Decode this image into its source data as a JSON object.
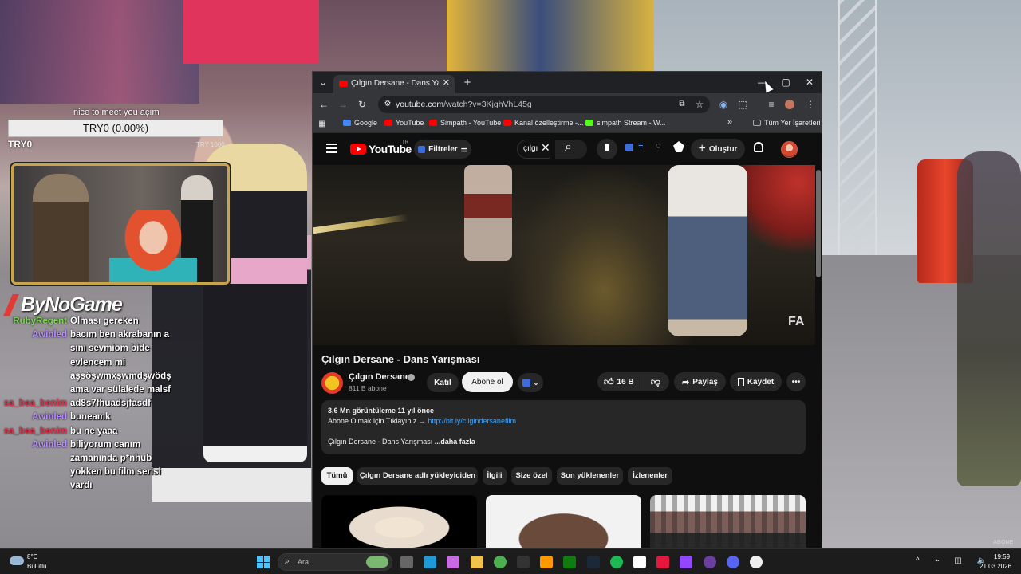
{
  "overlay": {
    "goal_text": "nice to meet you açım",
    "goal_label": "TRY0 (0.00%)",
    "goal_progress": 0,
    "goal_left": "TRY0",
    "goal_right": "TRY 1000",
    "logo_text": "ByNoGame",
    "watermark": "ABONE",
    "chat": [
      {
        "user": "RubyRegent",
        "msg": "Olması gereken",
        "color": "#7fd35a"
      },
      {
        "user": "Awinled",
        "msg": "bacım ben akrabanın a",
        "color": "#b98cff"
      },
      {
        "user": "",
        "msg": "sını sevmiom bide",
        "color": "#ffffff"
      },
      {
        "user": "",
        "msg": "evlencem mi",
        "color": "#ffffff"
      },
      {
        "user": "",
        "msg": "aşsöşwmxşwmdşwödş",
        "color": "#ffffff"
      },
      {
        "user": "",
        "msg": "ama var sülalede malsf",
        "color": "#ffffff"
      },
      {
        "user": "sa_bea_benim",
        "msg": "ad8s7fhuadsjfasdf",
        "color": "#e8304a"
      },
      {
        "user": "Awinled",
        "msg": "buneamk",
        "color": "#b98cff"
      },
      {
        "user": "sa_bea_benim",
        "msg": "bu ne yaaa",
        "color": "#e8304a"
      },
      {
        "user": "Awinled",
        "msg": "biliyorum canım",
        "color": "#b98cff"
      },
      {
        "user": "",
        "msg": "zamanında p*nhub",
        "color": "#ffffff"
      },
      {
        "user": "",
        "msg": "yokken bu film serisi",
        "color": "#ffffff"
      },
      {
        "user": "",
        "msg": "vardı",
        "color": "#ffffff"
      }
    ]
  },
  "browser": {
    "tab_title": "Çılgın Dersane - Dans Yarışması",
    "tab_close": "✕",
    "new_tab": "+",
    "tab_search": "⌄",
    "win_min": "—",
    "win_max": "▢",
    "win_close": "✕",
    "nav_back": "←",
    "nav_forward": "→",
    "nav_reload": "↻",
    "url_host": "youtube.com",
    "url_path": "/watch?v=3KjghVhL45g",
    "star": "☆",
    "menu": "⋮",
    "bookmarks": [
      {
        "label": "Google",
        "color": "#4285f4"
      },
      {
        "label": "YouTube",
        "color": "#ff0000"
      },
      {
        "label": "Simpath - YouTube",
        "color": "#ff0000"
      },
      {
        "label": "Kanal özelleştirme -...",
        "color": "#ff0000"
      },
      {
        "label": "simpath Stream - W...",
        "color": "#53fc18"
      }
    ],
    "bookmarks_more": "»",
    "all_bookmarks": "Tüm Yer İşaretleri"
  },
  "youtube": {
    "logo": "YouTube",
    "logo_tr": "TR",
    "filters": "Filtreler",
    "search_value": "çılgı",
    "search_clear": "✕",
    "search_icon": "⌕",
    "create": "Oluştur",
    "create_plus": "+",
    "video_watermark": "FA",
    "video_title": "Çılgın Dersane - Dans Yarışması",
    "channel_name": "Çılgın Dersane",
    "channel_subs": "811 B abone",
    "join": "Katıl",
    "subscribe": "Abone ol",
    "likes": "16 B",
    "share": "Paylaş",
    "save": "Kaydet",
    "more": "•••",
    "desc_stats": "3,6 Mn görüntüleme  11 yıl önce",
    "desc_line": "Abone Olmak için Tıklayınız → ",
    "desc_link": "http://bit.ly/cilgindersanefilm",
    "desc_title": "Çılgın Dersane - Dans Yarışması ",
    "desc_more": "...daha fazla",
    "chips": [
      {
        "label": "Tümü",
        "active": true
      },
      {
        "label": "Çılgın Dersane adlı yükleyiciden",
        "active": false
      },
      {
        "label": "İlgili",
        "active": false
      },
      {
        "label": "Size özel",
        "active": false
      },
      {
        "label": "Son yüklenenler",
        "active": false
      },
      {
        "label": "İzlenenler",
        "active": false
      }
    ]
  },
  "taskbar": {
    "weather_temp": "8°C",
    "weather_desc": "Bulutlu",
    "search_placeholder": "Ara",
    "search_icon": "⌕",
    "apps": [
      "task-view",
      "edge",
      "copilot",
      "file-explorer",
      "chrome",
      "epic-games",
      "amazon",
      "xbox",
      "steam",
      "spotify",
      "capcut",
      "opera-gx",
      "twitch",
      "obs",
      "discord",
      "github"
    ],
    "app_colors": [
      "#666666",
      "#1f9ad6",
      "#c86ae4",
      "#f2c14e",
      "#4caf50",
      "#333333",
      "#ff9900",
      "#107c10",
      "#1b2838",
      "#1db954",
      "#ffffff",
      "#e5173f",
      "#9146ff",
      "#6b3fa0",
      "#5865f2",
      "#eeeeee"
    ],
    "tray": "^ ⌁ ◫ 🔈",
    "time": "19:59",
    "date": "21.03.2026"
  }
}
